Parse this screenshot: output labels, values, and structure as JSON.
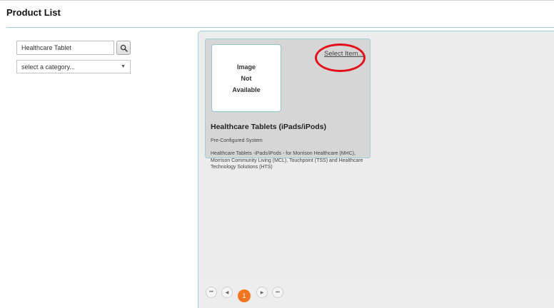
{
  "page": {
    "title": "Product List"
  },
  "search": {
    "value": "Healthcare Tablet",
    "button_icon": "search-icon"
  },
  "category": {
    "selected": "select a category..."
  },
  "product": {
    "image_text_1": "Image",
    "image_text_2": "Not",
    "image_text_3": "Available",
    "select_label": "Select Item...",
    "title": "Healthcare Tablets (iPads/iPods)",
    "subtitle": "Pre-Configured System",
    "description": "Healthcare Tablets -iPads/iPods - for Morrison Healthcare (MHC), Morrison Community Living (MCL), Touchpoint (TSS) and Healthcare Technology Solutions (HTS)"
  },
  "pager": {
    "current_page": "1",
    "first_icon": "⏮",
    "prev_icon": "◀",
    "next_icon": "▶",
    "last_icon": "⏭"
  },
  "colors": {
    "accent_orange": "#f47621",
    "highlight_red": "#e3101a",
    "border_teal": "#9fd3df"
  }
}
